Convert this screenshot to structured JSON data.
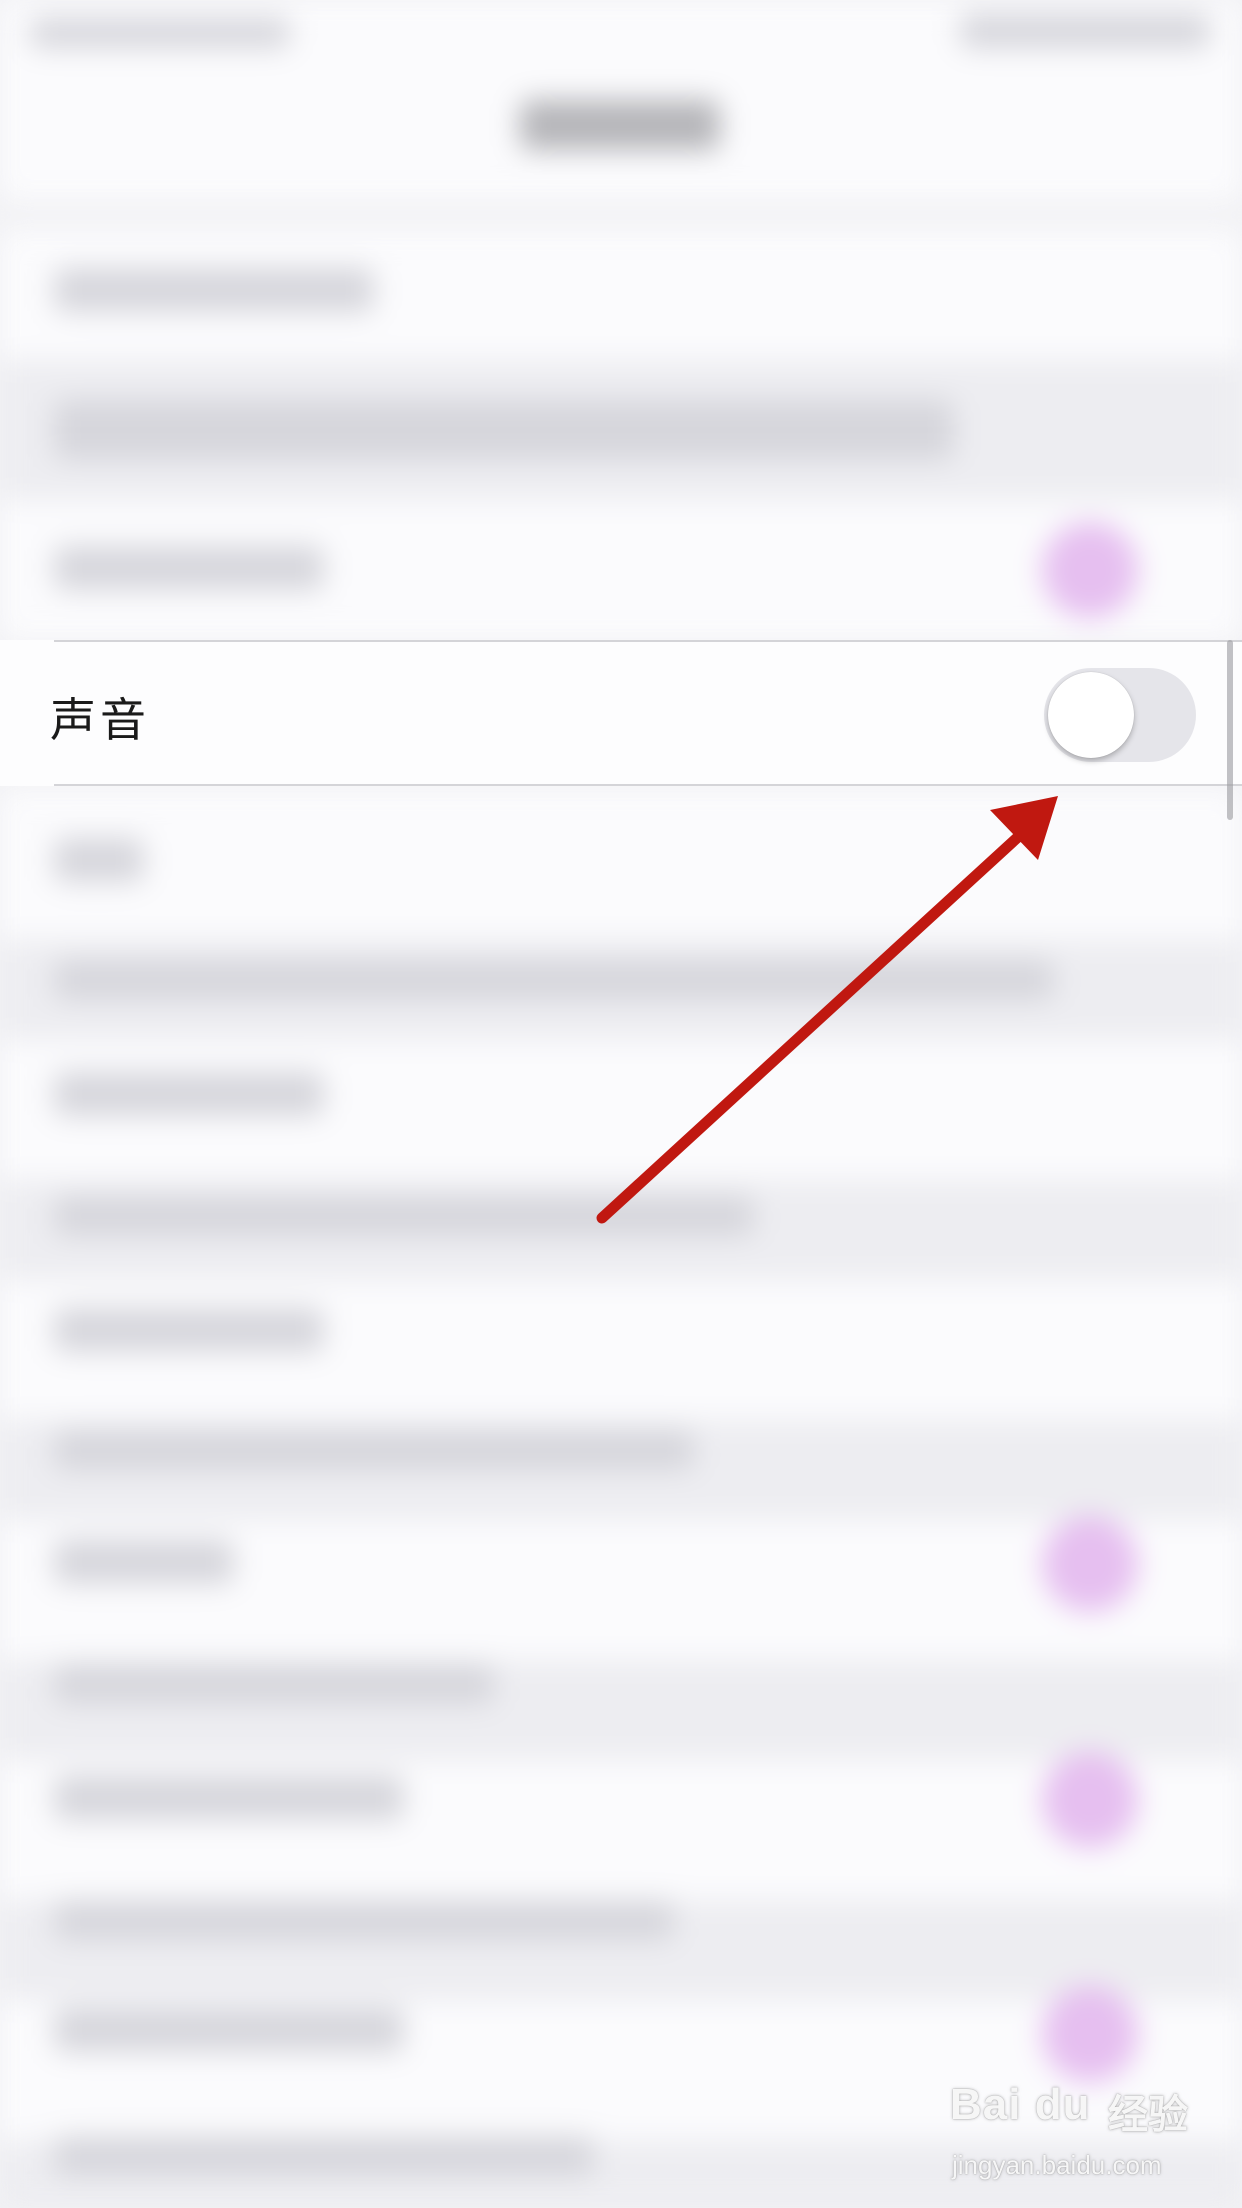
{
  "settings": {
    "sound_row": {
      "label": "声音",
      "toggle_on": false
    }
  },
  "watermark": {
    "brand": "Bai du",
    "cn": "经验",
    "url": "jingyan.baidu.com"
  },
  "colors": {
    "arrow": "#c01810",
    "toggle_off_track": "#e5e5ea"
  }
}
